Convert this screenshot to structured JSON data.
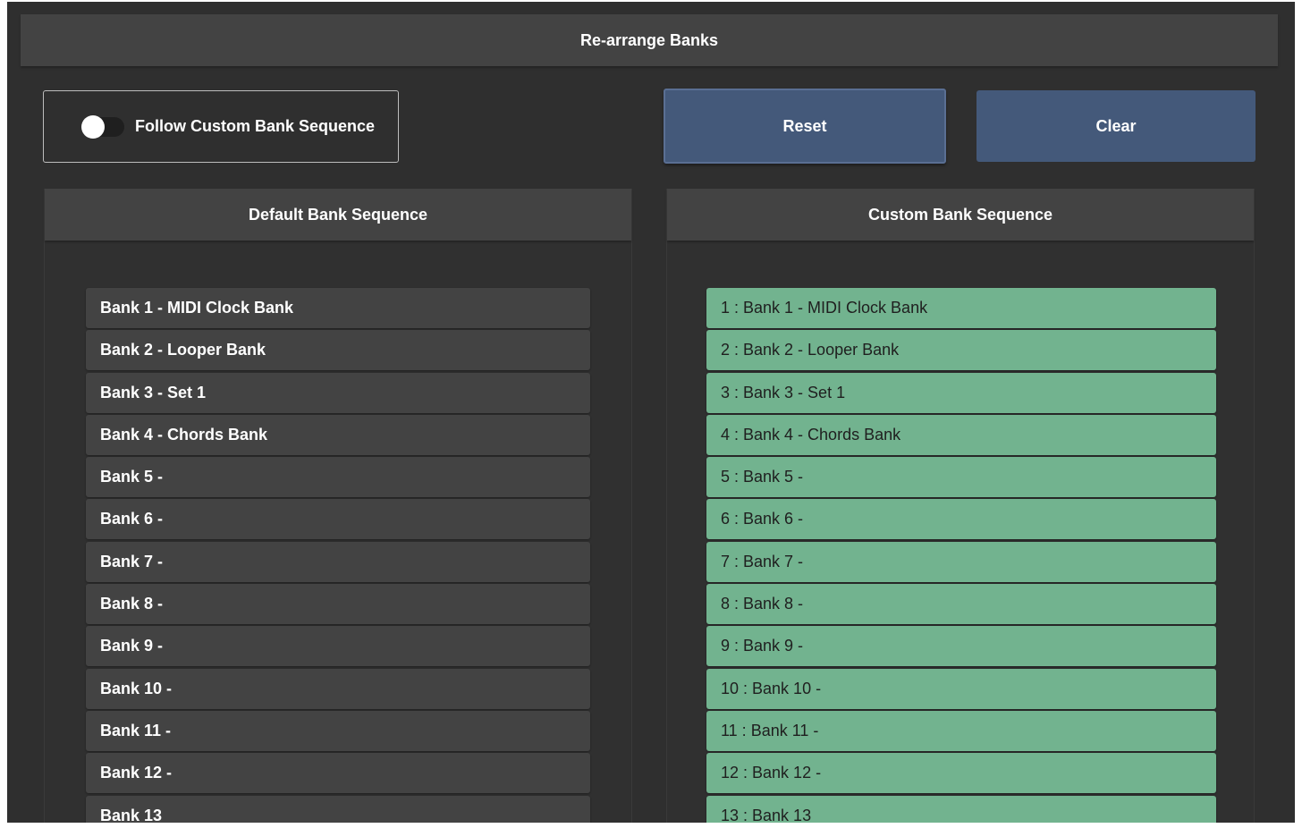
{
  "title": "Re-arrange Banks",
  "follow_toggle": {
    "label": "Follow Custom Bank Sequence",
    "state": "off"
  },
  "buttons": {
    "reset": "Reset",
    "clear": "Clear"
  },
  "default_panel": {
    "title": "Default Bank Sequence",
    "items": [
      "Bank 1 - MIDI Clock Bank",
      "Bank 2 - Looper Bank",
      "Bank 3 - Set 1",
      "Bank 4 - Chords Bank",
      "Bank 5 -",
      "Bank 6 -",
      "Bank 7 -",
      "Bank 8 -",
      "Bank 9 -",
      "Bank 10 -",
      "Bank 11 -",
      "Bank 12 -",
      "Bank 13"
    ]
  },
  "custom_panel": {
    "title": "Custom Bank Sequence",
    "items": [
      "1 : Bank 1 - MIDI Clock Bank",
      "2 : Bank 2 - Looper Bank",
      "3 : Bank 3 - Set 1",
      "4 : Bank 4 - Chords Bank",
      "5 : Bank 5 -",
      "6 : Bank 6 -",
      "7 : Bank 7 -",
      "8 : Bank 8 -",
      "9 : Bank 9 -",
      "10 : Bank 10 -",
      "11 : Bank 11 -",
      "12 : Bank 12 -",
      "13 : Bank 13"
    ]
  },
  "colors": {
    "background": "#2f2f2f",
    "header": "#434343",
    "button": "#44597a",
    "custom_item": "#72b38f"
  }
}
